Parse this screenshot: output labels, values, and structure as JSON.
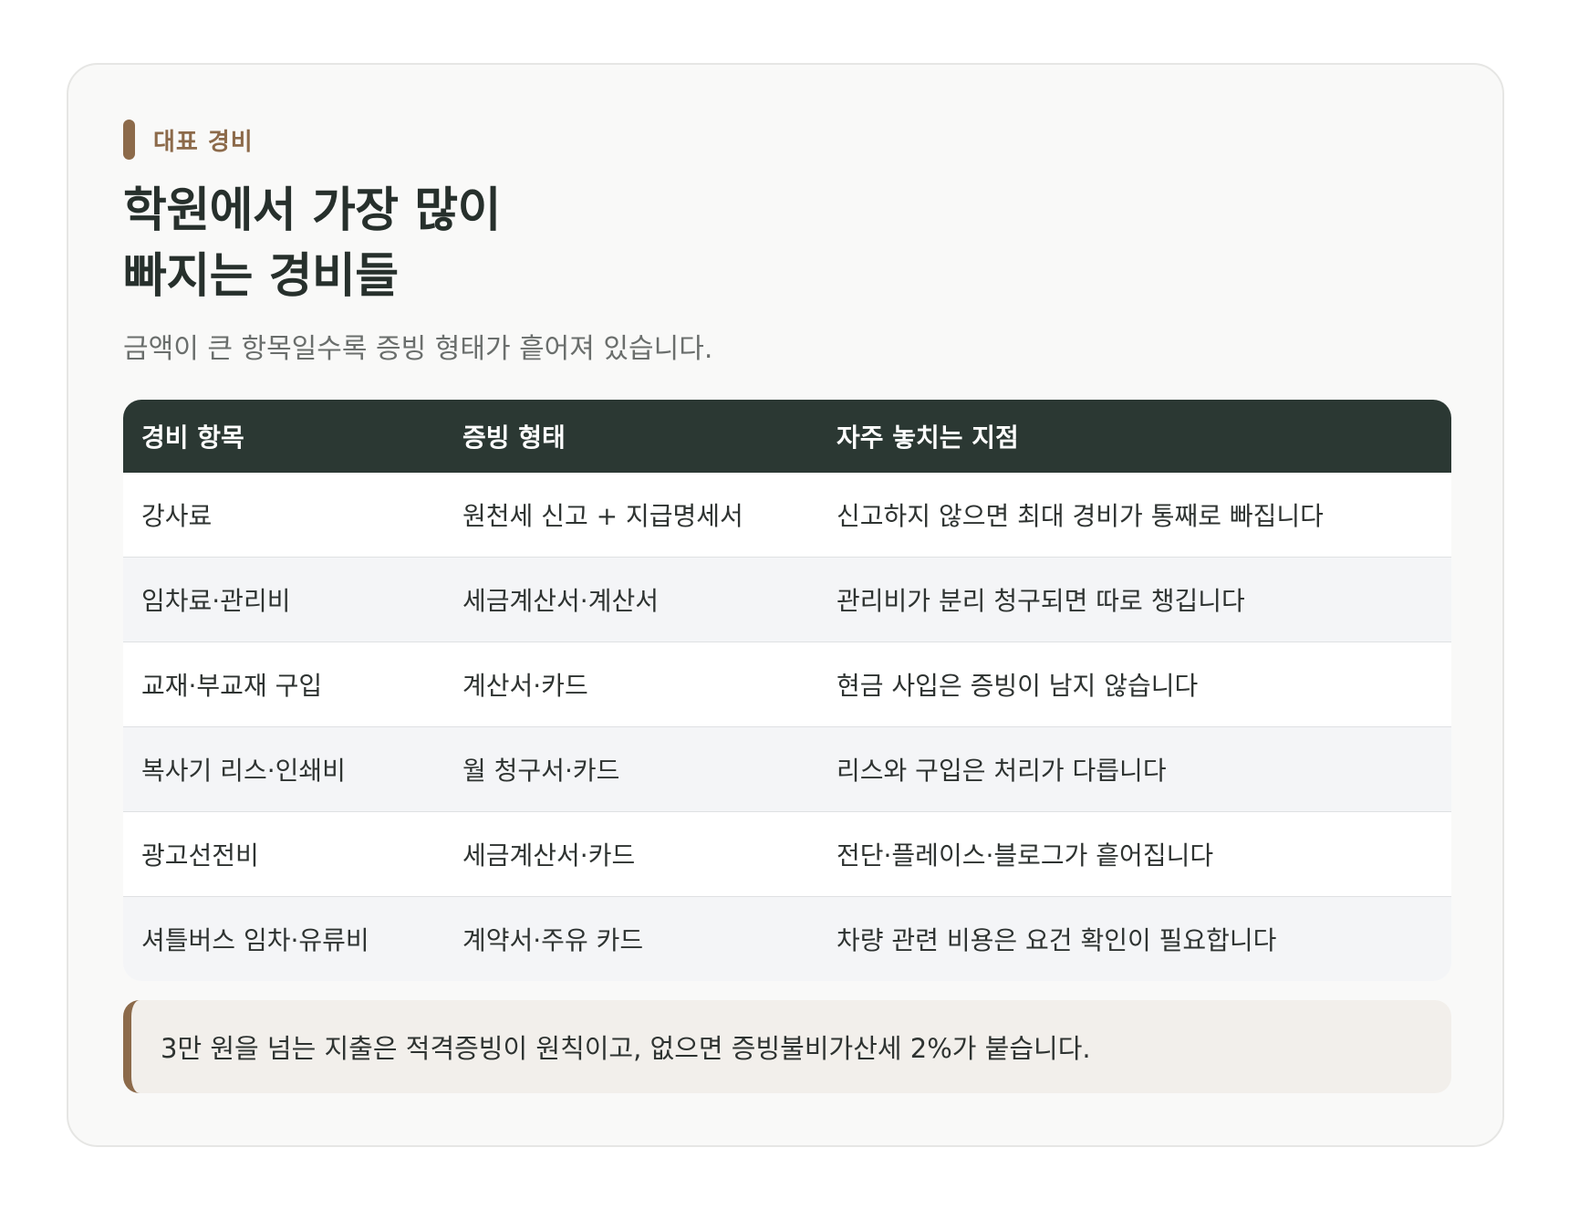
{
  "section_tag": "대표 경비",
  "title_line1": "학원에서 가장 많이",
  "title_line2": "빠지는 경비들",
  "subtitle": "금액이 큰 항목일수록 증빙 형태가 흩어져 있습니다.",
  "table": {
    "headers": [
      "경비 항목",
      "증빙 형태",
      "자주 놓치는 지점"
    ],
    "rows": [
      [
        "강사료",
        "원천세 신고 + 지급명세서",
        "신고하지 않으면 최대 경비가 통째로 빠집니다"
      ],
      [
        "임차료·관리비",
        "세금계산서·계산서",
        "관리비가 분리 청구되면 따로 챙깁니다"
      ],
      [
        "교재·부교재 구입",
        "계산서·카드",
        "현금 사입은 증빙이 남지 않습니다"
      ],
      [
        "복사기 리스·인쇄비",
        "월 청구서·카드",
        "리스와 구입은 처리가 다릅니다"
      ],
      [
        "광고선전비",
        "세금계산서·카드",
        "전단·플레이스·블로그가 흩어집니다"
      ],
      [
        "셔틀버스 임차·유류비",
        "계약서·주유 카드",
        "차량 관련 비용은 요건 확인이 필요합니다"
      ]
    ]
  },
  "note": "3만 원을 넘는 지출은 적격증빙이 원칙이고, 없으면 증빙불비가산세 2%가 붙습니다."
}
